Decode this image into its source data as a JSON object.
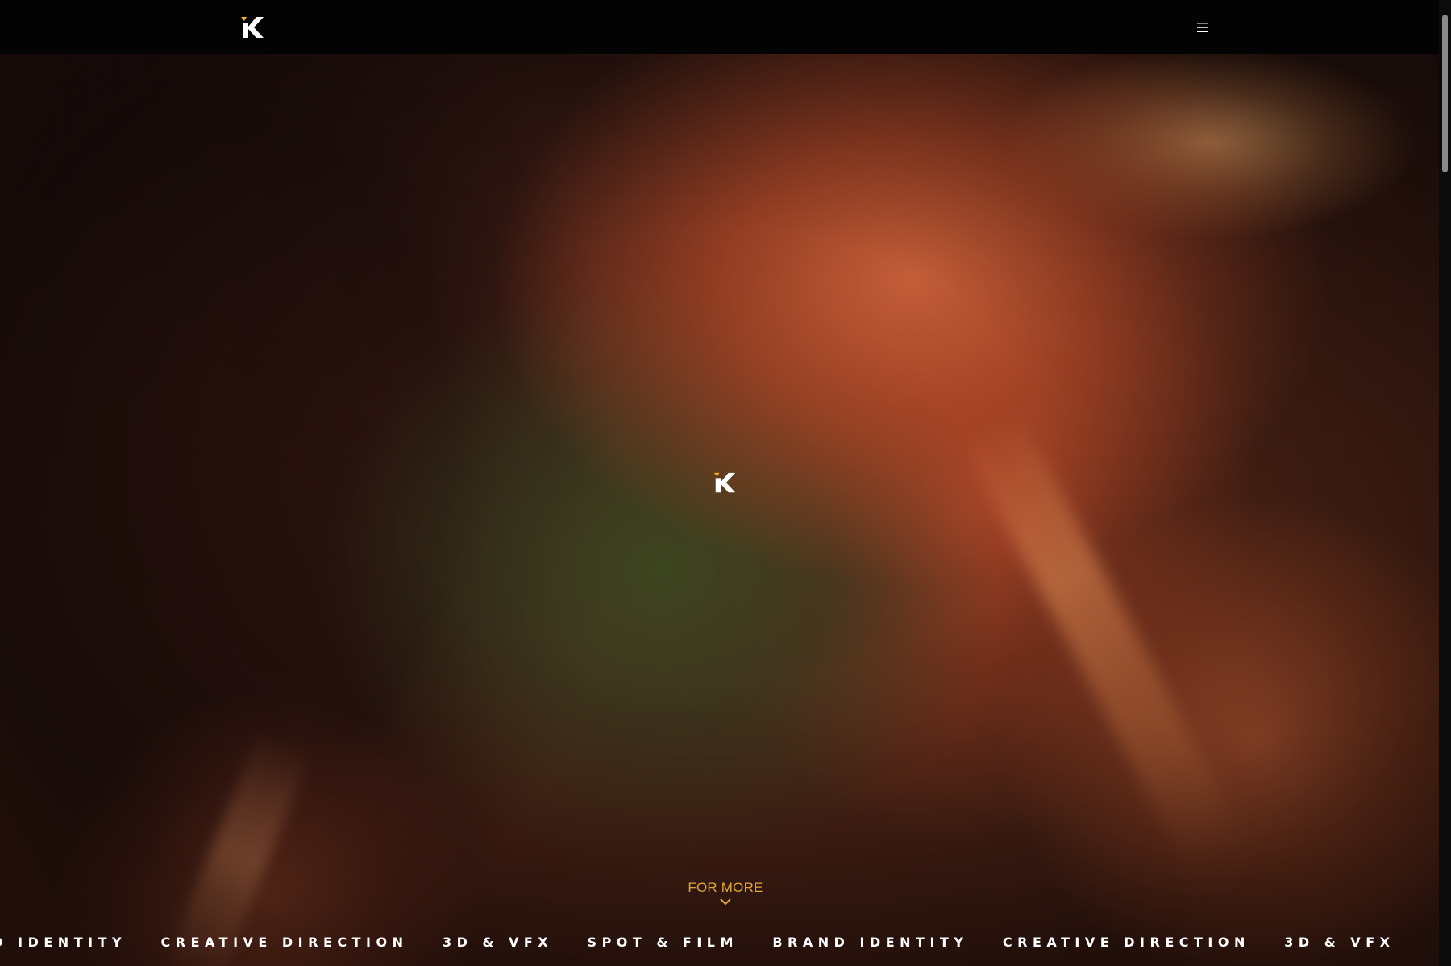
{
  "header": {
    "logo_icon": "k-logo-icon",
    "menu_icon": "hamburger-menu-icon"
  },
  "hero": {
    "center_logo_icon": "k-logo-icon",
    "scroll_prompt": "FOR MORE",
    "scroll_prompt_icon": "chevron-down-icon"
  },
  "marquee": {
    "items": [
      "BRAND IDENTITY",
      "CREATIVE DIRECTION",
      "3D & VFX",
      "SPOT & FILM",
      "BRAND IDENTITY",
      "CREATIVE DIRECTION",
      "3D & VFX"
    ]
  },
  "colors": {
    "accent": "#e0a832",
    "nav_background": "#030303",
    "marquee_text": "#ffffff"
  }
}
